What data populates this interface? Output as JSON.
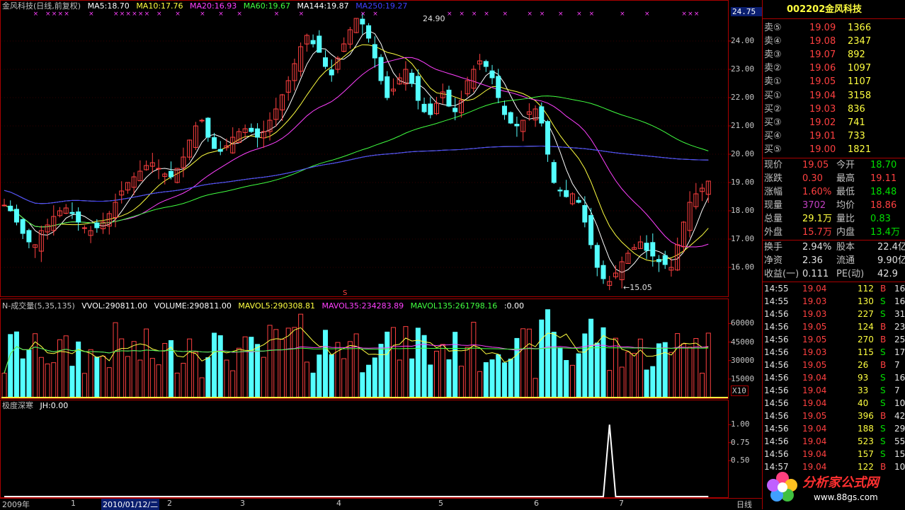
{
  "window": {
    "title": "金风科技(日线,前复权)"
  },
  "header": {
    "ma": [
      {
        "label": "MA5:18.70",
        "color": "#ffffff"
      },
      {
        "label": "MA10:17.76",
        "color": "#ffff40"
      },
      {
        "label": "MA20:16.93",
        "color": "#ff40ff"
      },
      {
        "label": "MA60:19.67",
        "color": "#40ff40"
      },
      {
        "label": "MA144:19.87",
        "color": "#ffffff"
      },
      {
        "label": "MA250:19.27",
        "color": "#4040ff"
      }
    ],
    "vol": [
      {
        "label": "N-成交量(5,35,135)",
        "color": "#c0c0c0"
      },
      {
        "label": "VVOL:290811.00",
        "color": "#ffffff"
      },
      {
        "label": "VOLUME:290811.00",
        "color": "#ffffff"
      },
      {
        "label": "MAVOL5:290308.81",
        "color": "#ffff40"
      },
      {
        "label": "MAVOL35:234283.89",
        "color": "#ff40ff"
      },
      {
        "label": "MAVOL135:261798.16",
        "color": "#40ff40"
      },
      {
        "label": ":0.00",
        "color": "#ffffff"
      }
    ],
    "ind": [
      {
        "label": "极度深寒",
        "color": "#c0c0c0"
      },
      {
        "label": "JH:0.00",
        "color": "#ffffff"
      }
    ]
  },
  "annotations": {
    "high": "24.90",
    "low": "←15.05",
    "s_mark": "S"
  },
  "price_axis": {
    "current": "24.75",
    "ticks": [
      "24.00",
      "23.00",
      "22.00",
      "21.00",
      "20.00",
      "19.00",
      "18.00",
      "17.00",
      "16.00"
    ]
  },
  "vol_axis": {
    "ticks": [
      "60000",
      "45000",
      "30000",
      "15000"
    ],
    "unit": "X10"
  },
  "ind_axis": {
    "ticks": [
      "1.00",
      "0.75",
      "0.50"
    ]
  },
  "x_axis": {
    "labels": [
      "2009年",
      "1",
      "2010/01/12/二",
      "2",
      "3",
      "4",
      "5",
      "6",
      "7"
    ],
    "period": "日线"
  },
  "quote": {
    "code": "002202",
    "name": "金风科技",
    "asks": [
      {
        "label": "卖⑤",
        "price": "19.09",
        "vol": "1366"
      },
      {
        "label": "卖④",
        "price": "19.08",
        "vol": "2347"
      },
      {
        "label": "卖③",
        "price": "19.07",
        "vol": "892"
      },
      {
        "label": "卖②",
        "price": "19.06",
        "vol": "1097"
      },
      {
        "label": "卖①",
        "price": "19.05",
        "vol": "1107"
      }
    ],
    "bids": [
      {
        "label": "买①",
        "price": "19.04",
        "vol": "3158"
      },
      {
        "label": "买②",
        "price": "19.03",
        "vol": "836"
      },
      {
        "label": "买③",
        "price": "19.02",
        "vol": "741"
      },
      {
        "label": "买④",
        "price": "19.01",
        "vol": "733"
      },
      {
        "label": "买⑤",
        "price": "19.00",
        "vol": "1821"
      }
    ],
    "stats": [
      {
        "k1": "现价",
        "v1": "19.05",
        "c1": "#ff4040",
        "k2": "今开",
        "v2": "18.70",
        "c2": "#00e000"
      },
      {
        "k1": "涨跌",
        "v1": "0.30",
        "c1": "#ff4040",
        "k2": "最高",
        "v2": "19.11",
        "c2": "#ff4040"
      },
      {
        "k1": "涨幅",
        "v1": "1.60%",
        "c1": "#ff4040",
        "k2": "最低",
        "v2": "18.48",
        "c2": "#00e000"
      },
      {
        "k1": "现量",
        "v1": "3702",
        "c1": "#c040c0",
        "k2": "均价",
        "v2": "18.86",
        "c2": "#ff4040"
      },
      {
        "k1": "总量",
        "v1": "29.1万",
        "c1": "#ffff40",
        "k2": "量比",
        "v2": "0.83",
        "c2": "#00e000"
      },
      {
        "k1": "外盘",
        "v1": "15.7万",
        "c1": "#ff4040",
        "k2": "内盘",
        "v2": "13.4万",
        "c2": "#00e000"
      }
    ],
    "finance": [
      {
        "k1": "换手",
        "v1": "2.94%",
        "k2": "股本",
        "v2": "22.4亿"
      },
      {
        "k1": "净资",
        "v1": "2.36",
        "k2": "流通",
        "v2": "9.90亿"
      },
      {
        "k1": "收益(一)",
        "v1": "0.111",
        "k2": "PE(动)",
        "v2": "42.9"
      }
    ],
    "ticks": [
      {
        "t": "14:55",
        "p": "19.04",
        "v": "112",
        "s": "B",
        "n": "16"
      },
      {
        "t": "14:55",
        "p": "19.03",
        "v": "130",
        "s": "S",
        "n": "16"
      },
      {
        "t": "14:56",
        "p": "19.03",
        "v": "227",
        "s": "S",
        "n": "31"
      },
      {
        "t": "14:56",
        "p": "19.05",
        "v": "124",
        "s": "B",
        "n": "23"
      },
      {
        "t": "14:56",
        "p": "19.05",
        "v": "270",
        "s": "B",
        "n": "25"
      },
      {
        "t": "14:56",
        "p": "19.03",
        "v": "115",
        "s": "S",
        "n": "17"
      },
      {
        "t": "14:56",
        "p": "19.05",
        "v": "26",
        "s": "B",
        "n": "7"
      },
      {
        "t": "14:56",
        "p": "19.04",
        "v": "93",
        "s": "S",
        "n": "16"
      },
      {
        "t": "14:56",
        "p": "19.04",
        "v": "33",
        "s": "S",
        "n": "7"
      },
      {
        "t": "14:56",
        "p": "19.04",
        "v": "40",
        "s": "S",
        "n": "10"
      },
      {
        "t": "14:56",
        "p": "19.05",
        "v": "396",
        "s": "B",
        "n": "42"
      },
      {
        "t": "14:56",
        "p": "19.04",
        "v": "188",
        "s": "S",
        "n": "29"
      },
      {
        "t": "14:56",
        "p": "19.04",
        "v": "523",
        "s": "S",
        "n": "55"
      },
      {
        "t": "14:56",
        "p": "19.04",
        "v": "157",
        "s": "S",
        "n": "15"
      },
      {
        "t": "14:57",
        "p": "19.04",
        "v": "122",
        "s": "B",
        "n": "10"
      }
    ]
  },
  "watermark": {
    "text": "分析家公式网",
    "url": "www.88gs.com"
  },
  "chart_data": {
    "type": "candlestick",
    "price_range": [
      15.0,
      25.0
    ],
    "closes": [
      18.2,
      18.0,
      17.6,
      17.2,
      16.9,
      16.8,
      17.3,
      17.5,
      17.8,
      18.0,
      18.1,
      17.9,
      17.6,
      17.4,
      17.3,
      17.4,
      17.6,
      17.9,
      18.3,
      18.7,
      19.0,
      19.2,
      19.4,
      19.6,
      19.7,
      19.5,
      19.3,
      19.2,
      19.5,
      19.9,
      20.5,
      21.0,
      21.2,
      20.6,
      20.2,
      20.1,
      20.3,
      20.6,
      20.8,
      20.9,
      20.8,
      20.6,
      20.8,
      21.2,
      21.6,
      22.1,
      22.6,
      23.2,
      23.8,
      24.2,
      23.9,
      23.6,
      23.1,
      22.8,
      23.4,
      23.9,
      24.4,
      24.8,
      24.6,
      24.1,
      23.4,
      22.6,
      22.0,
      22.3,
      22.7,
      23.0,
      22.5,
      21.9,
      21.5,
      21.4,
      21.8,
      22.2,
      21.7,
      21.5,
      21.9,
      22.6,
      23.0,
      23.3,
      23.1,
      22.7,
      22.0,
      21.4,
      21.1,
      21.0,
      21.2,
      21.5,
      21.6,
      21.1,
      20.0,
      19.0,
      18.7,
      18.5,
      18.6,
      18.3,
      17.6,
      16.8,
      16.0,
      15.6,
      15.5,
      15.8,
      16.2,
      16.5,
      16.7,
      16.9,
      16.6,
      16.4,
      16.2,
      16.1,
      16.0,
      16.8,
      17.6,
      18.3,
      18.6,
      18.8,
      19.05
    ],
    "volume_range": [
      0,
      70000
    ],
    "jh_range": [
      0,
      1.2
    ]
  }
}
